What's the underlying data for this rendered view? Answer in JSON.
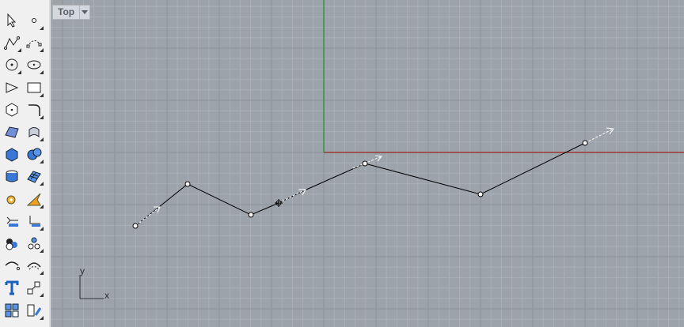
{
  "viewport": {
    "view_name": "Top",
    "axis_x_label": "x",
    "axis_y_label": "y"
  },
  "colors": {
    "background": "#9da3ab",
    "grid_minor": "#a9afb6",
    "grid_major": "#8c9299",
    "x_axis": "#9a3a2e",
    "y_axis": "#2f9a36",
    "curve": "#000000"
  },
  "toolbar": {
    "tools": [
      "select-arrow-icon",
      "point-icon",
      "polyline-icon",
      "curve-control-points-icon",
      "circle-icon",
      "ellipse-icon",
      "arc-icon",
      "rectangle-icon",
      "polygon-icon",
      "fillet-curve-icon",
      "surface-from-points-icon",
      "extrude-surface-icon",
      "box-solid-icon",
      "sphere-solid-icon",
      "cylinder-solid-icon",
      "mesh-plane-icon",
      "transform-gear-icon",
      "analyze-icon",
      "dimension-icon",
      "dimension-alt-icon",
      "render-spheres-icon",
      "object-properties-icon",
      "offset-curve-icon",
      "curve-arc-icon",
      "text-icon",
      "scale-icon",
      "group-blocks-icon",
      "layout-icon"
    ]
  }
}
